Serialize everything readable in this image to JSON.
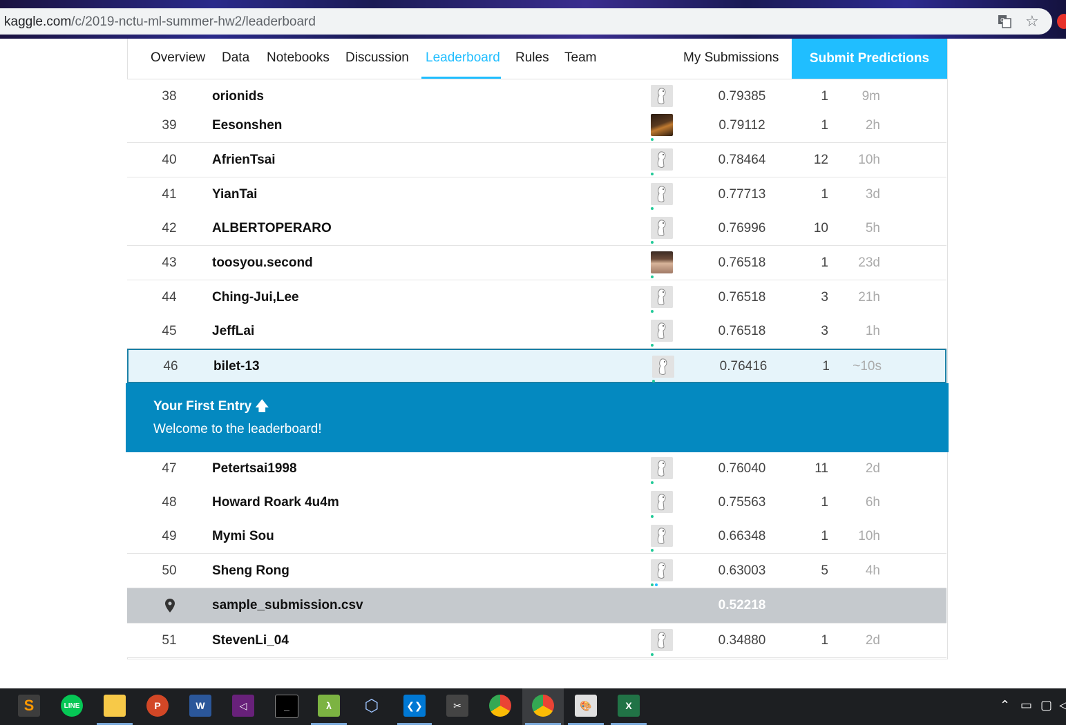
{
  "browser": {
    "url_host": "kaggle.com",
    "url_path": "/c/2019-nctu-ml-summer-hw2/leaderboard"
  },
  "nav": {
    "tabs": [
      "Overview",
      "Data",
      "Notebooks",
      "Discussion",
      "Leaderboard",
      "Rules",
      "Team"
    ],
    "active_tab": "Leaderboard",
    "my_submissions": "My Submissions",
    "submit": "Submit Predictions"
  },
  "rows_top": [
    {
      "rank": "38",
      "name": "orionids",
      "score": "0.79385",
      "entries": "1",
      "last": "9m",
      "avatar": "goose"
    },
    {
      "rank": "39",
      "name": "Eesonshen",
      "score": "0.79112",
      "entries": "1",
      "last": "2h",
      "avatar": "photo-guitar"
    },
    {
      "rank": "40",
      "name": "AfrienTsai",
      "score": "0.78464",
      "entries": "12",
      "last": "10h",
      "avatar": "goose"
    },
    {
      "rank": "41",
      "name": "YianTai",
      "score": "0.77713",
      "entries": "1",
      "last": "3d",
      "avatar": "goose"
    },
    {
      "rank": "42",
      "name": "ALBERTOPERARO",
      "score": "0.76996",
      "entries": "10",
      "last": "5h",
      "avatar": "goose"
    },
    {
      "rank": "43",
      "name": "toosyou.second",
      "score": "0.76518",
      "entries": "1",
      "last": "23d",
      "avatar": "photo-face"
    },
    {
      "rank": "44",
      "name": "Ching-Jui,Lee",
      "score": "0.76518",
      "entries": "3",
      "last": "21h",
      "avatar": "goose"
    },
    {
      "rank": "45",
      "name": "JeffLai",
      "score": "0.76518",
      "entries": "3",
      "last": "1h",
      "avatar": "goose"
    }
  ],
  "my_row": {
    "rank": "46",
    "name": "bilet-13",
    "score": "0.76416",
    "entries": "1",
    "last": "~10s",
    "avatar": "goose"
  },
  "banner": {
    "title": "Your First Entry",
    "arrow_icon": "arrow-up-icon",
    "message": "Welcome to the leaderboard!"
  },
  "rows_bottom": [
    {
      "rank": "47",
      "name": "Petertsai1998",
      "score": "0.76040",
      "entries": "11",
      "last": "2d",
      "avatar": "goose"
    },
    {
      "rank": "48",
      "name": "Howard Roark 4u4m",
      "score": "0.75563",
      "entries": "1",
      "last": "6h",
      "avatar": "goose"
    },
    {
      "rank": "49",
      "name": "Mymi Sou",
      "score": "0.66348",
      "entries": "1",
      "last": "10h",
      "avatar": "goose"
    },
    {
      "rank": "50",
      "name": "Sheng Rong",
      "score": "0.63003",
      "entries": "5",
      "last": "4h",
      "avatar": "goose"
    }
  ],
  "benchmark": {
    "name": "sample_submission.csv",
    "score": "0.52218",
    "icon": "map-pin-icon"
  },
  "rows_last": [
    {
      "rank": "51",
      "name": "StevenLi_04",
      "score": "0.34880",
      "entries": "1",
      "last": "2d",
      "avatar": "goose"
    }
  ],
  "taskbar": {
    "apps": [
      "sublime-text",
      "line",
      "file-explorer",
      "powerpoint",
      "word",
      "visual-studio",
      "terminal",
      "app-green",
      "virtualbox",
      "vscode",
      "snipping-tool",
      "chrome",
      "chrome-active",
      "paint",
      "excel"
    ]
  },
  "colors": {
    "accent": "#20beff",
    "banner": "#0489c0",
    "highlight_row_bg": "#e6f4fa",
    "benchmark_bg": "#c5c9cd"
  }
}
